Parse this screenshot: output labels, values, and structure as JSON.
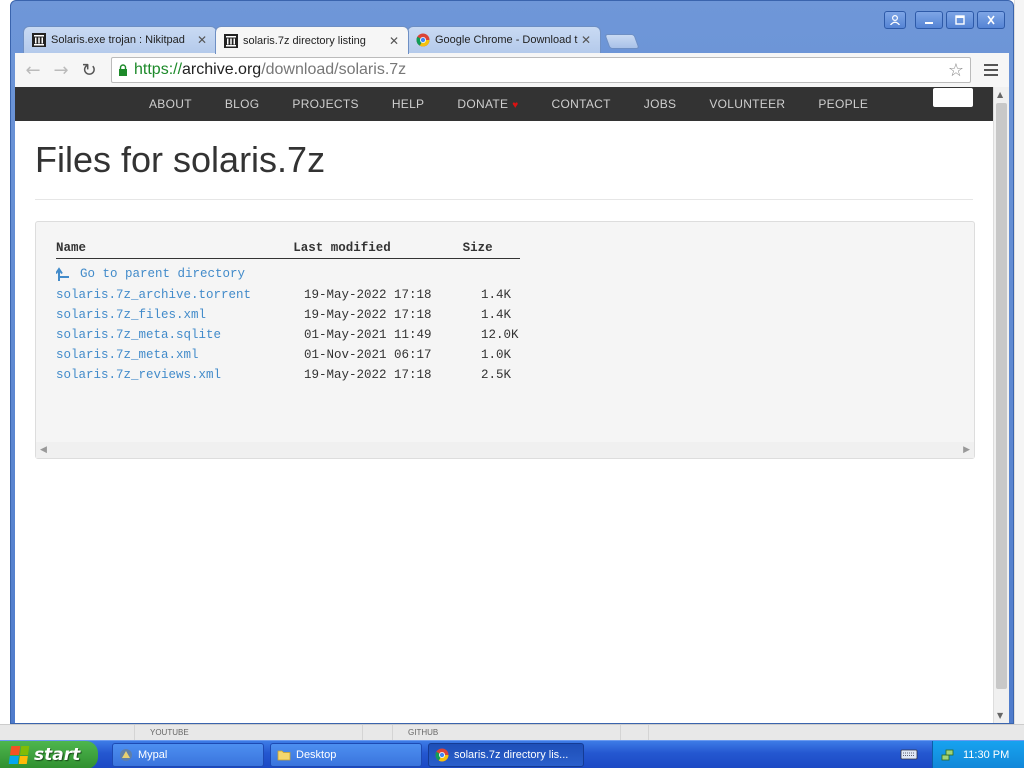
{
  "browser": {
    "tabs": [
      {
        "title": "Solaris.exe trojan : Nikitpad",
        "active": false
      },
      {
        "title": "solaris.7z directory listing",
        "active": true
      },
      {
        "title": "Google Chrome - Download t",
        "active": false
      }
    ],
    "url": {
      "protocol": "https://",
      "host": "archive.org",
      "path": "/download/solaris.7z"
    }
  },
  "site_nav": {
    "items": [
      "ABOUT",
      "BLOG",
      "PROJECTS",
      "HELP",
      "DONATE",
      "CONTACT",
      "JOBS",
      "VOLUNTEER",
      "PEOPLE"
    ]
  },
  "page": {
    "title": "Files for solaris.7z"
  },
  "listing": {
    "headers": {
      "name": "Name",
      "modified": "Last modified",
      "size": "Size"
    },
    "parent_link": "Go to parent directory",
    "files": [
      {
        "name": "solaris.7z_archive.torrent",
        "modified": "19-May-2022 17:18",
        "size": "1.4K"
      },
      {
        "name": "solaris.7z_files.xml",
        "modified": "19-May-2022 17:18",
        "size": "1.4K"
      },
      {
        "name": "solaris.7z_meta.sqlite",
        "modified": "01-May-2021 11:49",
        "size": "12.0K"
      },
      {
        "name": "solaris.7z_meta.xml",
        "modified": "01-Nov-2021 06:17",
        "size": "1.0K"
      },
      {
        "name": "solaris.7z_reviews.xml",
        "modified": "19-May-2022 17:18",
        "size": "2.5K"
      }
    ]
  },
  "background_window": {
    "labels": [
      "YOUTUBE",
      "GITHUB"
    ]
  },
  "taskbar": {
    "start_label": "start",
    "tasks": [
      {
        "label": "Mypal",
        "active": false
      },
      {
        "label": "Desktop",
        "active": false
      },
      {
        "label": "solaris.7z directory lis...",
        "active": true
      }
    ],
    "clock": "11:30 PM"
  },
  "colors": {
    "link": "#428bca",
    "nav_bg": "#333333",
    "xp_blue": "#2457d0",
    "start_green": "#2f8f2f"
  }
}
